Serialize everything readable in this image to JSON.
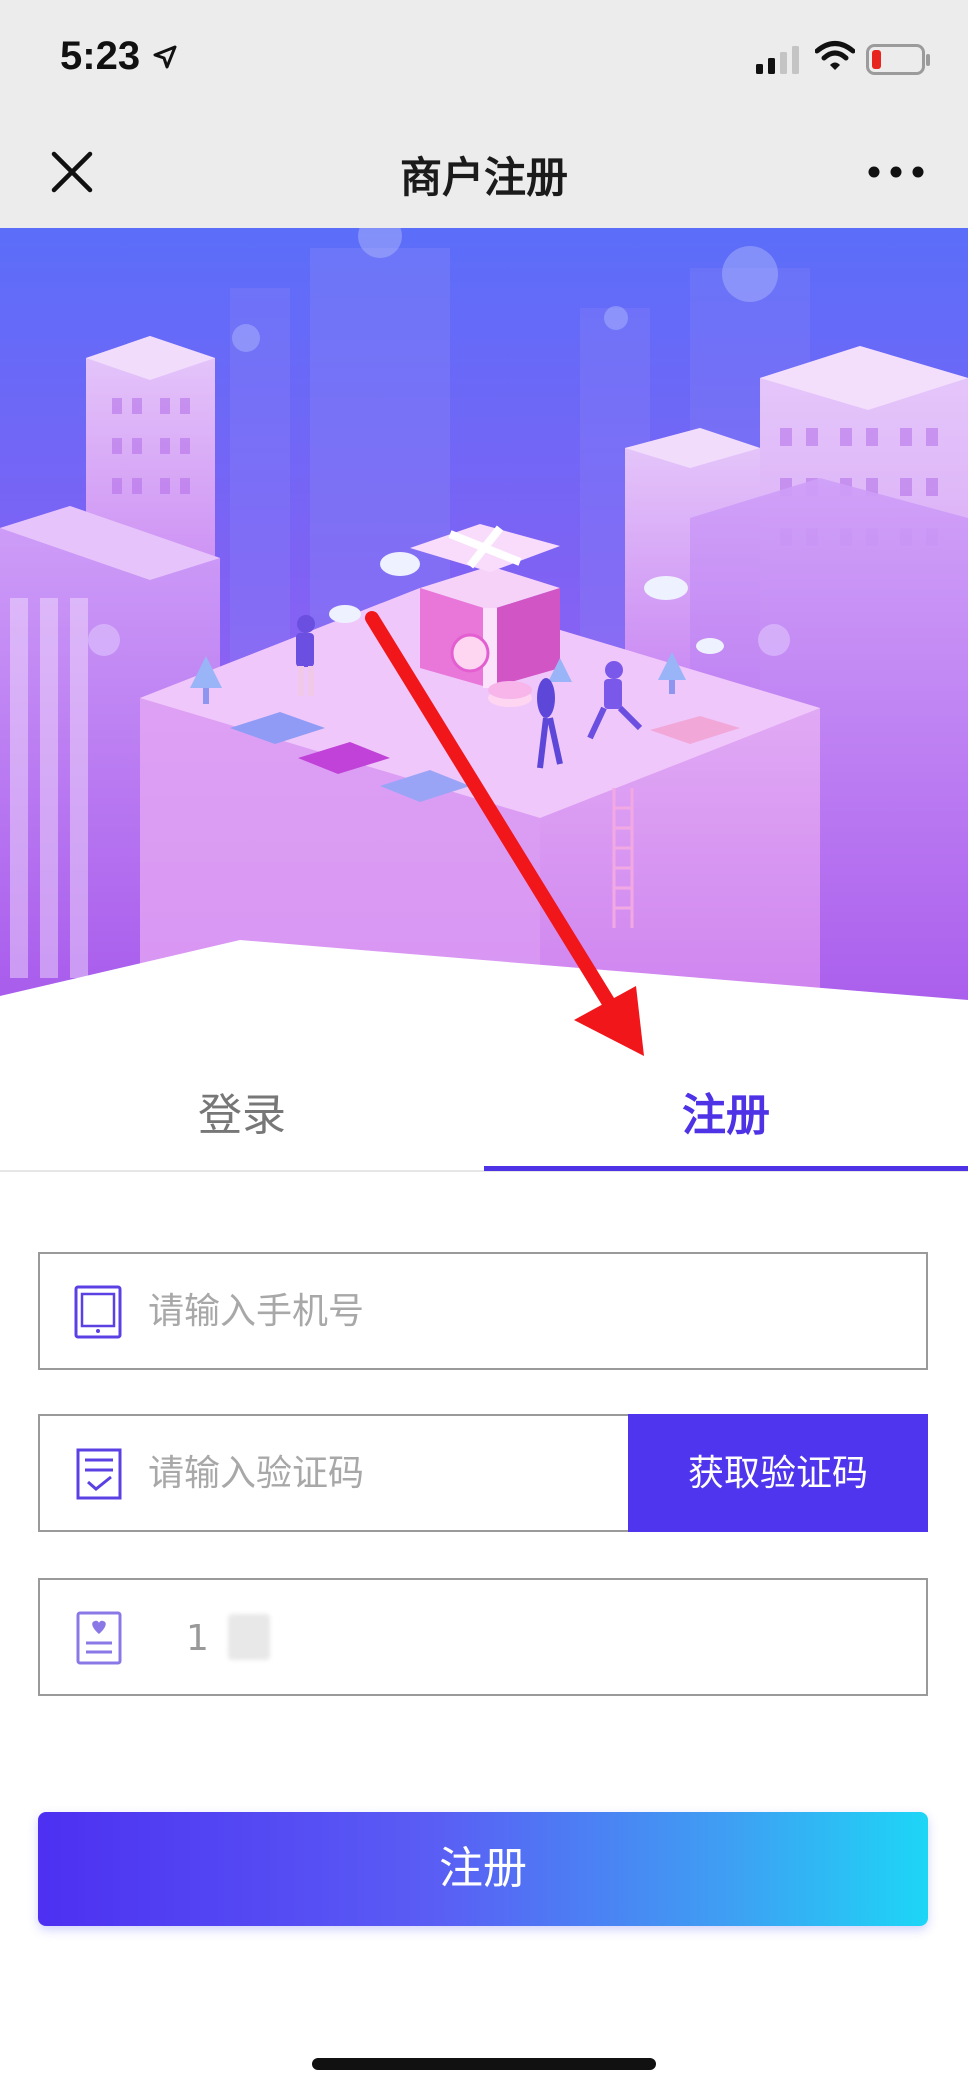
{
  "status_bar": {
    "time": "5:23",
    "icons": [
      "location-arrow-icon",
      "cellular-signal-icon",
      "wifi-icon",
      "battery-low-icon"
    ],
    "battery_color": "#e8241e"
  },
  "nav": {
    "title": "商户注册",
    "close_icon": "close-icon",
    "more_icon": "more-dots-icon"
  },
  "tabs": {
    "login_label": "登录",
    "register_label": "注册",
    "active": "注册",
    "active_color": "#4d32e6"
  },
  "form": {
    "phone": {
      "placeholder": "请输入手机号",
      "value": "",
      "icon": "phone-icon"
    },
    "code": {
      "placeholder": "请输入验证码",
      "value": "",
      "icon": "verification-code-icon"
    },
    "get_code_label": "获取验证码",
    "invite": {
      "value": "1",
      "icon": "id-card-icon"
    }
  },
  "submit_label": "注册",
  "colors": {
    "primary": "#4f36ee",
    "gradient_start": "#4d30f2",
    "gradient_end": "#1dd6f6"
  }
}
